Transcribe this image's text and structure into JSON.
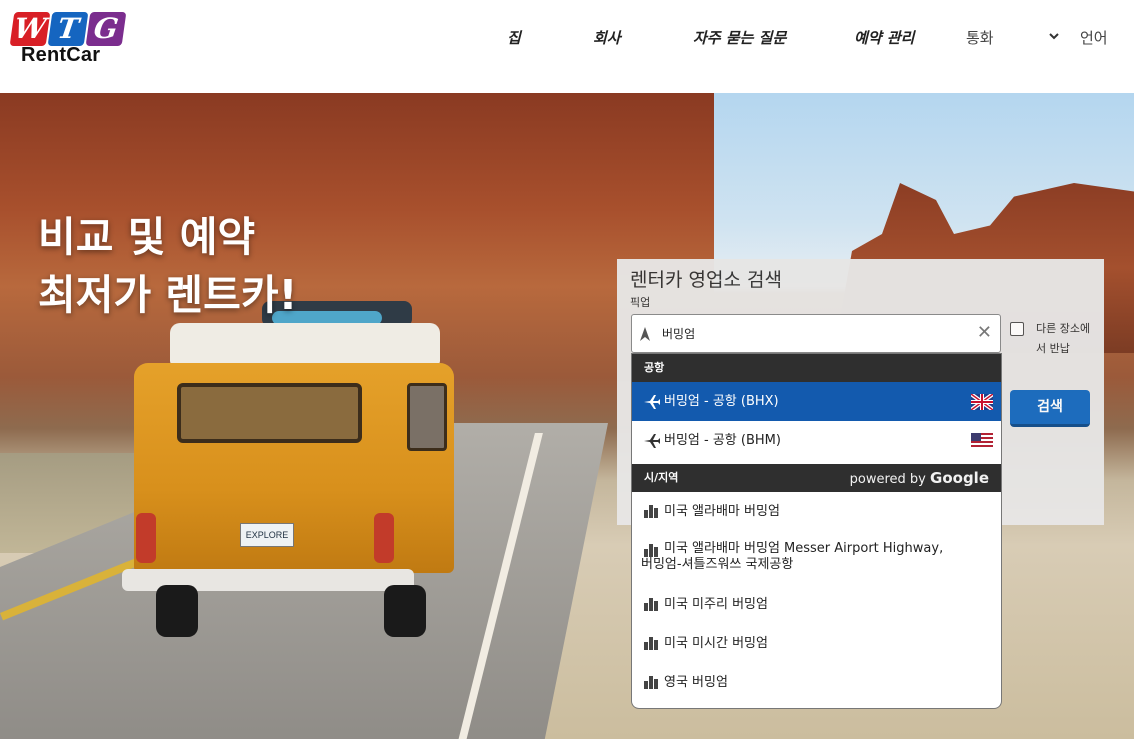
{
  "brand": {
    "logo_letters": [
      "W",
      "T",
      "G"
    ],
    "logo_text": "RentCar"
  },
  "nav": {
    "items": [
      "집",
      "회사",
      "자주 묻는 질문",
      "예약 관리"
    ],
    "currency_label": "통화",
    "language_label": "언어"
  },
  "hero": {
    "title_line1": "비교 및 예약",
    "title_line2": "최저가 렌트카!",
    "plate_text": "EXPLORE"
  },
  "search": {
    "title": "렌터카 영업소 검색",
    "pickup_label": "픽업",
    "pickup_value": "버밍엄",
    "return_other_label": "다른 장소에서 반납",
    "return_other_checked": false,
    "search_button": "검색",
    "clear_symbol": "✕"
  },
  "dropdown": {
    "airports_header": "공항",
    "airports": [
      {
        "label": "버밍엄 - 공항 (BHX)",
        "flag": "uk-flag",
        "active": true
      },
      {
        "label": "버밍엄 - 공항 (BHM)",
        "flag": "us-flag",
        "active": false
      }
    ],
    "cities_header": "시/지역",
    "powered_prefix": "powered by",
    "powered_brand": "Google",
    "cities": [
      {
        "line1": "미국 앨라배마 버밍엄",
        "line2": ""
      },
      {
        "line1": "미국 앨라배마 버밍엄 Messer Airport Highway,",
        "line2": "버밍엄-셔틀즈워쓰 국제공항"
      },
      {
        "line1": "미국 미주리 버밍엄",
        "line2": ""
      },
      {
        "line1": "미국 미시간 버밍엄",
        "line2": ""
      },
      {
        "line1": "영국 버밍엄",
        "line2": ""
      }
    ]
  },
  "colors": {
    "primary": "#1a6dc1",
    "active_row": "#135aae",
    "section_header": "#2f2f2f"
  }
}
